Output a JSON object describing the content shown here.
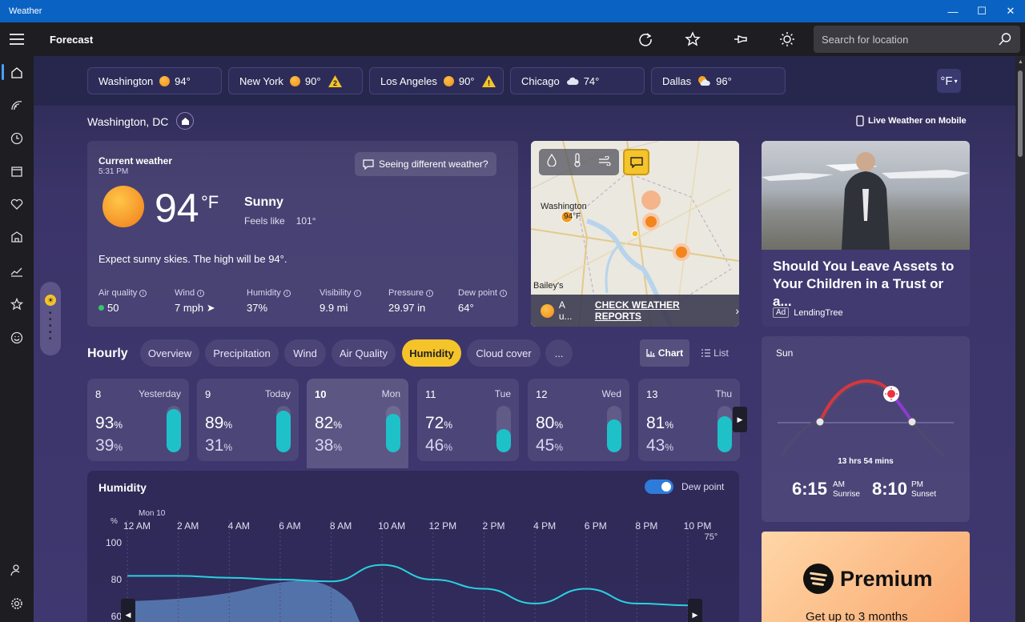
{
  "window": {
    "title": "Weather"
  },
  "topbar": {
    "app_name": "Forecast",
    "search_placeholder": "Search for location"
  },
  "cities": [
    {
      "name": "Washington",
      "temp": "94°",
      "icon": "sun-icon",
      "alert": ""
    },
    {
      "name": "New York",
      "temp": "90°",
      "icon": "sun-icon",
      "alert": "2"
    },
    {
      "name": "Los Angeles",
      "temp": "90°",
      "icon": "sun-icon",
      "alert": "!"
    },
    {
      "name": "Chicago",
      "temp": "74°",
      "icon": "cloud-icon",
      "alert": ""
    },
    {
      "name": "Dallas",
      "temp": "96°",
      "icon": "partly-cloudy-icon",
      "alert": ""
    }
  ],
  "unit_toggle": "°F",
  "location": {
    "name": "Washington, DC",
    "live_link": "Live Weather on Mobile"
  },
  "current": {
    "title": "Current weather",
    "time": "5:31 PM",
    "temp": "94",
    "unit": "°F",
    "condition": "Sunny",
    "feels_label": "Feels like",
    "feels_value": "101°",
    "summary": "Expect sunny skies. The high will be 94°.",
    "seeing": "Seeing different weather?",
    "metrics": [
      {
        "label": "Air quality",
        "value": "50"
      },
      {
        "label": "Wind",
        "value": "7 mph"
      },
      {
        "label": "Humidity",
        "value": "37%"
      },
      {
        "label": "Visibility",
        "value": "9.9 mi"
      },
      {
        "label": "Pressure",
        "value": "29.97 in"
      },
      {
        "label": "Dew point",
        "value": "64°"
      }
    ]
  },
  "map": {
    "city_label": "Washington",
    "city_temp": "94°F",
    "corner_label": "Bailey's",
    "footer_short": "A u...",
    "footer_link": "CHECK WEATHER REPORTS"
  },
  "ad1": {
    "title": "Should You Leave Assets to Your Children in a Trust or a...",
    "badge": "Ad",
    "sponsor": "LendingTree"
  },
  "hourly": {
    "title": "Hourly",
    "tabs": [
      "Overview",
      "Precipitation",
      "Wind",
      "Air Quality",
      "Humidity",
      "Cloud cover",
      "..."
    ],
    "active_tab": "Humidity",
    "view_chart": "Chart",
    "view_list": "List"
  },
  "days": [
    {
      "num": "8",
      "day": "Yesterday",
      "hi": "93",
      "lo": "39",
      "pct": "%",
      "fill": 0.93
    },
    {
      "num": "9",
      "day": "Today",
      "hi": "89",
      "lo": "31",
      "pct": "%",
      "fill": 0.89
    },
    {
      "num": "10",
      "day": "Mon",
      "hi": "82",
      "lo": "38",
      "pct": "%",
      "fill": 0.82
    },
    {
      "num": "11",
      "day": "Tue",
      "hi": "72",
      "lo": "46",
      "pct": "%",
      "fill": 0.5
    },
    {
      "num": "12",
      "day": "Wed",
      "hi": "80",
      "lo": "45",
      "pct": "%",
      "fill": 0.7
    },
    {
      "num": "13",
      "day": "Thu",
      "hi": "81",
      "lo": "43",
      "pct": "%",
      "fill": 0.78
    }
  ],
  "humidity_chart": {
    "title": "Humidity",
    "dew_label": "Dew point",
    "date_label": "Mon 10",
    "yunit": "%",
    "right_label": "75°",
    "times": [
      "12 AM",
      "2 AM",
      "4 AM",
      "6 AM",
      "8 AM",
      "10 AM",
      "12 PM",
      "2 PM",
      "4 PM",
      "6 PM",
      "8 PM",
      "10 PM"
    ],
    "yticks": [
      "100",
      "80",
      "60"
    ]
  },
  "chart_data": {
    "type": "line",
    "x": [
      "12 AM",
      "2 AM",
      "4 AM",
      "6 AM",
      "8 AM",
      "10 AM",
      "12 PM",
      "2 PM",
      "4 PM",
      "6 PM",
      "8 PM",
      "10 PM"
    ],
    "series": [
      {
        "values": [
          82,
          82,
          81,
          80,
          79,
          88,
          80,
          75,
          67,
          75,
          67,
          66
        ]
      }
    ],
    "ylim": [
      60,
      100
    ],
    "yticks": [
      60,
      80,
      100
    ]
  },
  "sun": {
    "title": "Sun",
    "day_length": "13 hrs 54 mins",
    "sunrise": "6:15",
    "sunrise_ampm": "AM",
    "sunrise_label": "Sunrise",
    "sunset": "8:10",
    "sunset_ampm": "PM",
    "sunset_label": "Sunset"
  },
  "ad2": {
    "brand": "Premium",
    "text": "Get up to 3 months"
  },
  "colors": {
    "accent_yellow": "#f5c32a",
    "bar_teal": "#1fc1c9",
    "line_cyan": "#29d1e0",
    "titlebar_blue": "#0a63c2"
  }
}
